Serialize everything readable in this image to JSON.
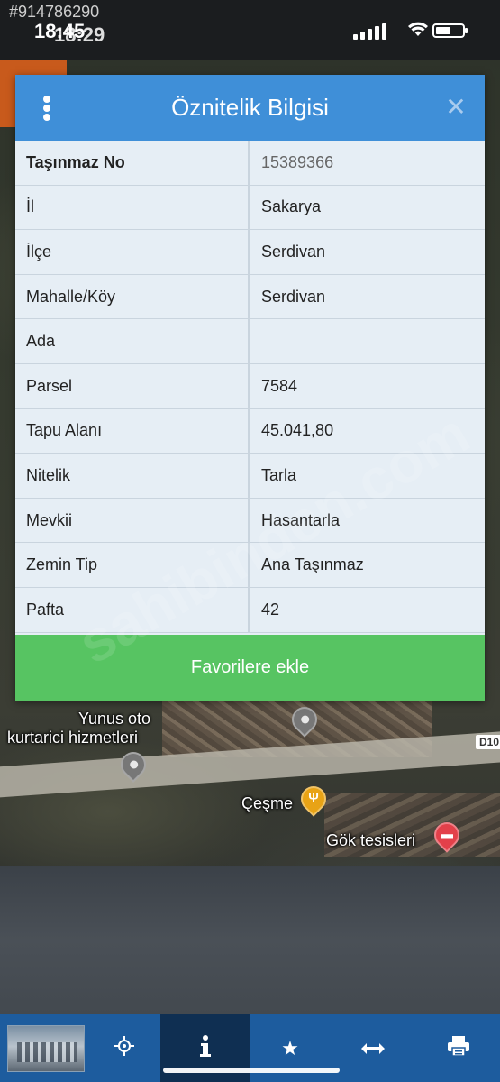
{
  "status_bar": {
    "watermark_id": "#914786290",
    "time": "18:45",
    "time_overlap": "18:29"
  },
  "dialog": {
    "title": "Öznitelik Bilgisi",
    "rows": [
      {
        "key": "Taşınmaz No",
        "value": "15389366"
      },
      {
        "key": "İl",
        "value": "Sakarya"
      },
      {
        "key": "İlçe",
        "value": "Serdivan"
      },
      {
        "key": "Mahalle/Köy",
        "value": "Serdivan"
      },
      {
        "key": "Ada",
        "value": ""
      },
      {
        "key": "Parsel",
        "value": "7584"
      },
      {
        "key": "Tapu Alanı",
        "value": "45.041,80"
      },
      {
        "key": "Nitelik",
        "value": "Tarla"
      },
      {
        "key": "Mevkii",
        "value": "Hasantarla"
      },
      {
        "key": "Zemin Tip",
        "value": "Ana Taşınmaz"
      },
      {
        "key": "Pafta",
        "value": "42"
      }
    ],
    "favorite_button": "Favorilere ekle"
  },
  "map": {
    "labels": {
      "place1_line1": "Yunus oto",
      "place1_line2": "kurtarici hizmetleri",
      "place2": "Çeşme",
      "place3": "Gök tesisleri",
      "road": "D10"
    }
  },
  "watermark": "sahibinden.com",
  "toolbar": {
    "icons": [
      "locate-icon",
      "info-icon",
      "star-icon",
      "measure-icon",
      "print-icon"
    ],
    "active": "info-icon"
  },
  "colors": {
    "header_blue": "#3f8fd8",
    "favorite_green": "#57c462",
    "toolbar_blue": "#1d5c9e"
  }
}
